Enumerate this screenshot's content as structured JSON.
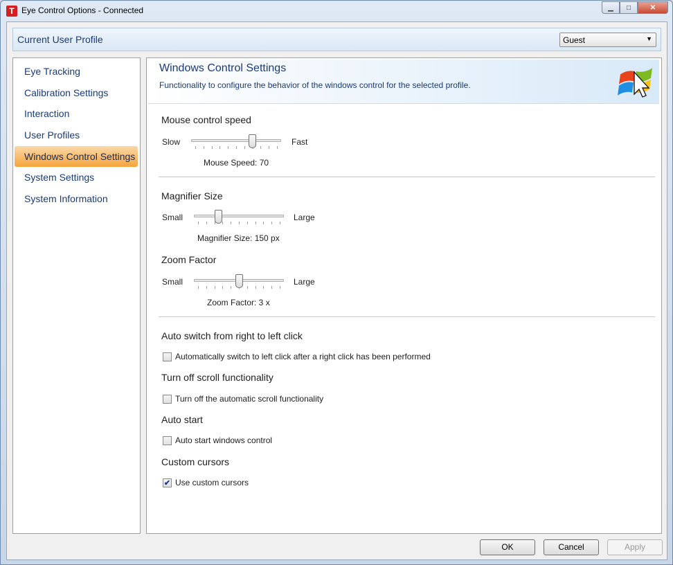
{
  "window": {
    "title": "Eye Control Options - Connected",
    "app_icon_letter": "T",
    "minimize_glyph": "▁",
    "maximize_glyph": "□",
    "close_glyph": "✕"
  },
  "profile": {
    "label": "Current User Profile",
    "selected": "Guest",
    "arrow": "▼"
  },
  "sidebar": {
    "items": [
      {
        "label": "Eye Tracking",
        "active": false
      },
      {
        "label": "Calibration Settings",
        "active": false
      },
      {
        "label": "Interaction",
        "active": false
      },
      {
        "label": "User Profiles",
        "active": false
      },
      {
        "label": "Windows Control Settings",
        "active": true
      },
      {
        "label": "System Settings",
        "active": false
      },
      {
        "label": "System Information",
        "active": false
      }
    ]
  },
  "header": {
    "title": "Windows Control Settings",
    "description": "Functionality to configure the behavior of the windows control for the selected profile.",
    "logo_icon": "windows-logo-icon"
  },
  "mouse_speed": {
    "section_title": "Mouse control speed",
    "min_label": "Slow",
    "max_label": "Fast",
    "value_text": "Mouse Speed: 70",
    "level": 0.7
  },
  "magnifier": {
    "section_title": "Magnifier Size",
    "min_label": "Small",
    "max_label": "Large",
    "value_text": "Magnifier Size: 150 px",
    "level": 0.25
  },
  "zoom": {
    "section_title": "Zoom Factor",
    "min_label": "Small",
    "max_label": "Large",
    "value_text": "Zoom Factor: 3 x",
    "level": 0.5
  },
  "options": {
    "auto_switch": {
      "title": "Auto switch from right to left click",
      "checkbox_label": "Automatically switch to left click after a right click has been performed",
      "checked": false
    },
    "scroll": {
      "title": "Turn off scroll functionality",
      "checkbox_label": "Turn off the automatic scroll functionality",
      "checked": false
    },
    "auto_start": {
      "title": "Auto start",
      "checkbox_label": "Auto start windows control",
      "checked": false
    },
    "custom_cursors": {
      "title": "Custom cursors",
      "checkbox_label": "Use custom cursors",
      "checked": true,
      "check_glyph": "✔"
    }
  },
  "buttons": {
    "ok": "OK",
    "cancel": "Cancel",
    "apply": "Apply"
  },
  "colors": {
    "active_nav": "#f6a43c",
    "link_text": "#1a3a78"
  }
}
